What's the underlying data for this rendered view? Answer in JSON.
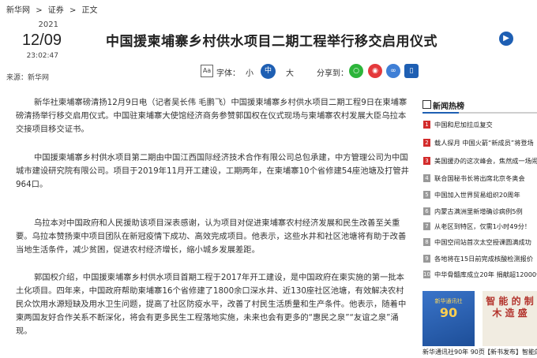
{
  "breadcrumb": {
    "site": "新华网",
    "sep1": ">",
    "section": "证券",
    "sep2": ">",
    "page": "正文"
  },
  "date": {
    "year": "2021",
    "month_day": "12/09",
    "time": "23:02:47"
  },
  "source": "来源：新华网",
  "title": "中国援柬埔寨乡村供水项目二期工程举行移交启用仪式",
  "toolbar": {
    "font_icon": "Aa",
    "font_label": "字体：",
    "size_small": "小",
    "size_medium": "中",
    "size_large": "大",
    "share_label": "分享到："
  },
  "icons": {
    "speaker": "speaker-icon",
    "share": [
      "wechat-icon",
      "weibo-icon",
      "link-icon",
      "mobile-icon"
    ],
    "share_colors": [
      "#2db53b",
      "#e4393c",
      "#3f7fd6",
      "#1e5fb3"
    ]
  },
  "article": {
    "paragraphs": [
      "新华社柬埔寨磅清扬12月9日电（记者吴长伟 毛鹏飞）中国援柬埔寨乡村供水项目二期工程9日在柬埔寨磅清扬举行移交启用仪式。中国驻柬埔寨大使馆经济商务参赞郭国权在仪式现场与柬埔寨农村发展大臣乌拉本交接项目移交证书。",
      "中国援柬埔寨乡村供水项目第二期由中国江西国际经济技术合作有限公司总包承建，中方管理公司为中国城市建设研究院有限公司。项目于2019年11月开工建设，工期两年，在柬埔寨10个省修建54座池塘及打管井964口。",
      "乌拉本对中国政府和人民援助该项目深表感谢，认为项目对促进柬埔寨农村经济发展和民生改善至关重要。乌拉本赞扬柬中项目团队在新冠疫情下成功、高效完成项目。他表示，这些水井和社区池塘将有助于改善当地生活条件，减少贫困，促进农村经济增长，缩小城乡发展差距。",
      "郭国权介绍，中国援柬埔寨乡村供水项目首期工程于2017年开工建设，是中国政府在柬实施的第一批本土化项目。四年来，中国政府帮助柬埔寨16个省修建了1800余口深水井、近130座社区池塘，有效解决农村民众饮用水源短缺及用水卫生问题，提高了社区防疫水平，改善了村民生活质量和生产条件。他表示，随着中柬两国友好合作关系不断深化，将会有更多民生工程落地实施，未来也会有更多的“惠民之泉”“友谊之泉”涌现。"
    ]
  },
  "sidebar": {
    "heading": "新闻热榜",
    "items": [
      {
        "num": "1",
        "text": "中国和尼加拉瓜复交"
      },
      {
        "num": "2",
        "text": "载人探月 中国火箭“新成员”将登场"
      },
      {
        "num": "3",
        "text": "美国援办的这次峰会，焦然成一场闹剧"
      },
      {
        "num": "4",
        "text": "联合国秘书长将出席北京冬奥会"
      },
      {
        "num": "5",
        "text": "中国加入世界贸易组织20周年"
      },
      {
        "num": "6",
        "text": "内蒙古满洲里新增确诊病例5例"
      },
      {
        "num": "7",
        "text": "从老区到特区，仅需1小时49分！"
      },
      {
        "num": "8",
        "text": "中国空间站首次太空授课圆满成功"
      },
      {
        "num": "9",
        "text": "各地将在15日前完成核酸检测报价"
      },
      {
        "num": "10",
        "text": "中华骨髓库成立20年 捐献超12000例"
      }
    ],
    "books": [
      {
        "caption": "新华通讯社90年 90页",
        "cover_top": "新华通讯社",
        "cover_big": "90"
      },
      {
        "caption": "【新书发布】智能的",
        "cover_text": "智 能 的 制 木 造 盛"
      }
    ]
  }
}
